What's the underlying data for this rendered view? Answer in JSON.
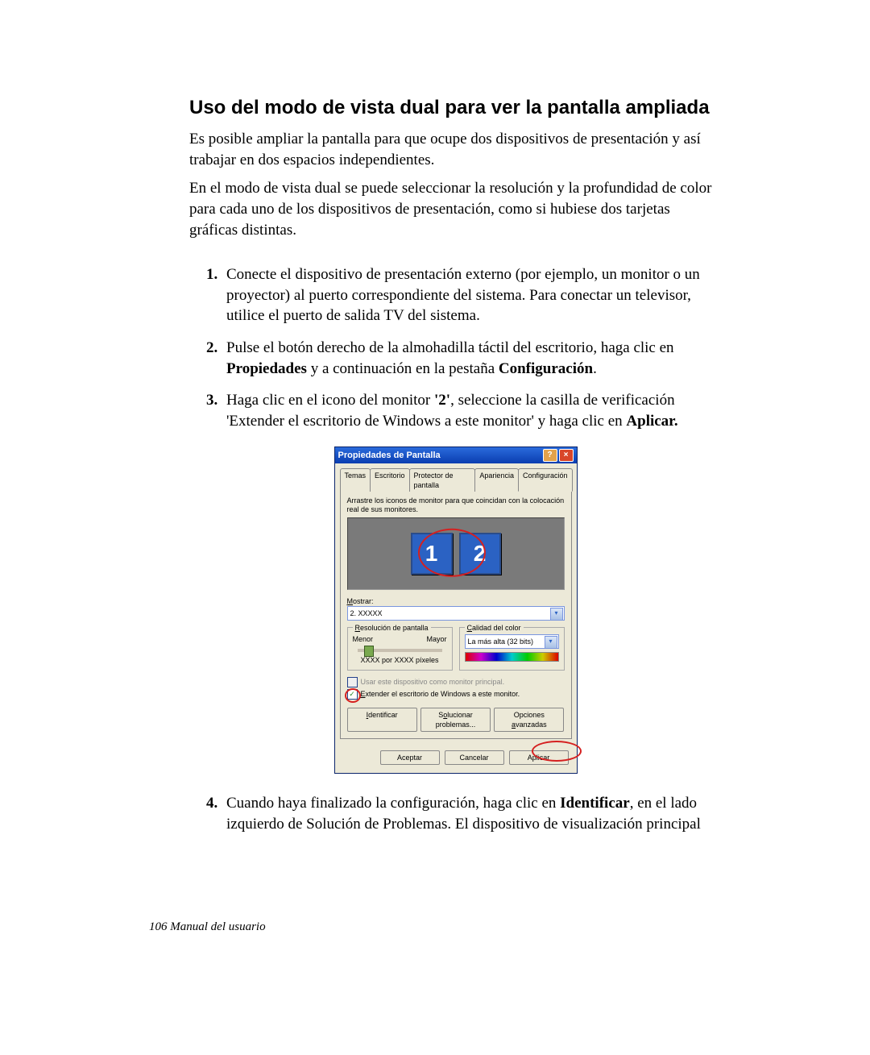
{
  "page": {
    "heading": "Uso del modo de vista dual para ver la pantalla ampliada",
    "para1": "Es posible ampliar la pantalla para que ocupe dos dispositivos de presentación y así trabajar en dos espacios independientes.",
    "para2": "En el modo de vista dual se puede seleccionar la resolución y la profundidad de color para cada uno de los dispositivos de presentación, como si hubiese dos tarjetas gráficas distintas.",
    "step1": "Conecte el dispositivo de presentación externo (por ejemplo, un monitor o un proyector) al puerto correspondiente del sistema. Para conectar un televisor, utilice el puerto de salida TV del sistema.",
    "step2a": "Pulse el botón derecho de la almohadilla táctil del escritorio, haga clic en ",
    "step2b": "Propiedades",
    "step2c": " y a continuación en la pestaña ",
    "step2d": "Configuración",
    "step2e": ".",
    "step3a": "Haga clic en el icono del monitor ",
    "step3b": "'2'",
    "step3c": ", seleccione la casilla de verificación 'Extender el escritorio de Windows a este monitor' y haga clic en ",
    "step3d": "Aplicar.",
    "step4a": "Cuando haya finalizado la configuración, haga clic en ",
    "step4b": "Identificar",
    "step4c": ", en el lado izquierdo de Solución de Problemas. El dispositivo de visualización principal",
    "footer": "106  Manual del usuario"
  },
  "dialog": {
    "title": "Propiedades de Pantalla",
    "tabs": [
      "Temas",
      "Escritorio",
      "Protector de pantalla",
      "Apariencia",
      "Configuración"
    ],
    "active_tab": 4,
    "drag_hint": "Arrastre los iconos de monitor para que coincidan con la colocación real de sus monitores.",
    "mon1": "1",
    "mon2": "2",
    "mostrar_label": "Mostrar:",
    "mostrar_value": "2. XXXXX",
    "res_legend": "Resolución de pantalla",
    "res_menor": "Menor",
    "res_mayor": "Mayor",
    "res_value": "XXXX por XXXX píxeles",
    "color_legend": "Calidad del color",
    "color_value": "La más alta (32 bits)",
    "cb_primary": "Usar este dispositivo como monitor principal.",
    "cb_extend": "Extender el escritorio de Windows a este monitor.",
    "btn_identify": "Identificar",
    "btn_trouble": "Solucionar problemas...",
    "btn_advanced": "Opciones avanzadas",
    "btn_ok": "Aceptar",
    "btn_cancel": "Cancelar",
    "btn_apply": "Aplicar"
  }
}
